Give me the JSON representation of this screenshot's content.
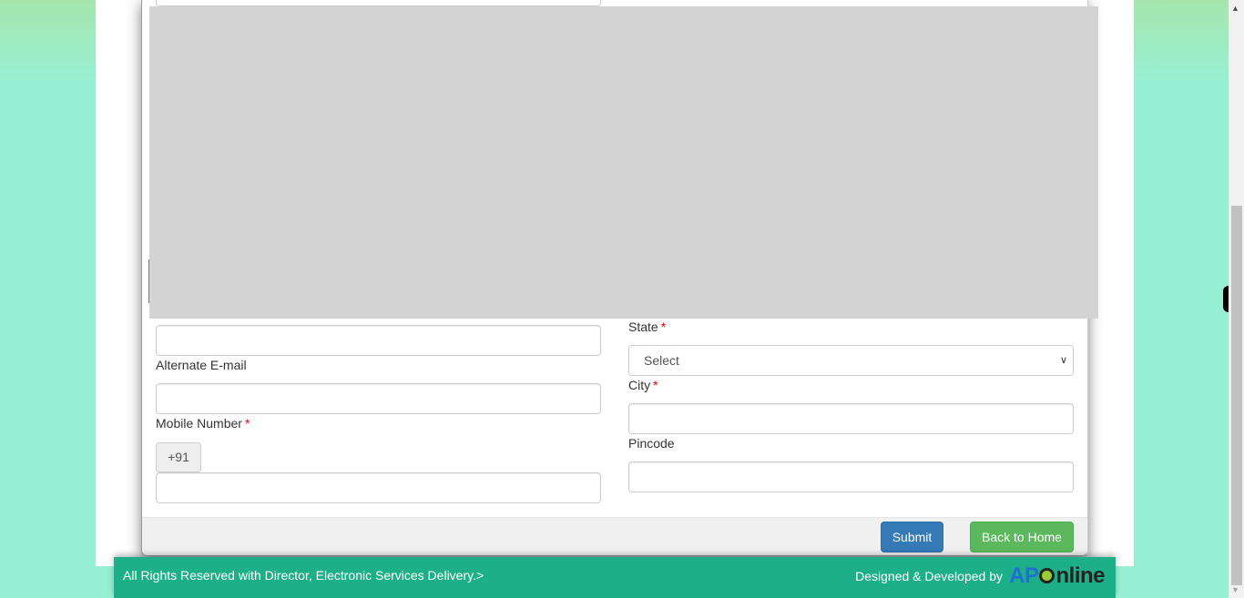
{
  "form": {
    "left": {
      "alternate_email_label": "Alternate E-mail",
      "alternate_email_value": "",
      "mobile_label": "Mobile Number",
      "mobile_required": "*",
      "country_code": "+91",
      "mobile_value": "",
      "top_input_value": ""
    },
    "right": {
      "state_label": "State",
      "state_required": "*",
      "state_selected": "Select",
      "city_label": "City",
      "city_required": "*",
      "city_value": "",
      "pincode_label": "Pincode",
      "pincode_value": ""
    }
  },
  "footer_buttons": {
    "submit": "Submit",
    "back": "Back to Home"
  },
  "site_footer": {
    "copyright": "All Rights Reserved with Director, Electronic Services Delivery.>",
    "credit": "Designed & Developed by",
    "logo_ap": "AP",
    "logo_rest": "nline"
  },
  "icons": {
    "chevron": "⌄",
    "scroll_up": "▲",
    "scroll_down": "▼"
  },
  "colors": {
    "primary": "#337ab7",
    "success": "#5cb85c",
    "footer_bg": "#1db088",
    "required": "#ee0000"
  }
}
